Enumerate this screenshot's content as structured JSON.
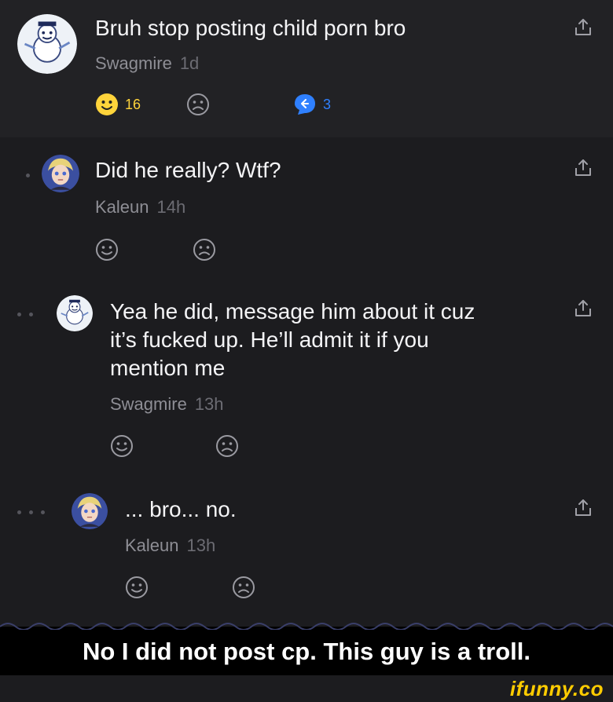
{
  "comments": [
    {
      "text": "Bruh stop posting child porn bro",
      "author": "Swagmire",
      "time": "1d",
      "smile_count": "16",
      "reply_count": "3"
    },
    {
      "text": "Did he really? Wtf?",
      "author": "Kaleun",
      "time": "14h"
    },
    {
      "text_lines": [
        "Yea he did, message him about it cuz",
        "it’s fucked up. He’ll admit it if you",
        "mention me"
      ],
      "author": "Swagmire",
      "time": "13h"
    },
    {
      "text": "... bro... no.",
      "author": "Kaleun",
      "time": "13h"
    }
  ],
  "caption": "No I did not post cp. This guy is a troll.",
  "watermark": "ifunny.co",
  "colors": {
    "smile_active": "#ffd43b",
    "reply_blue": "#2f80ff",
    "background": "#1c1c1f",
    "top_comment_bg": "#222225"
  },
  "icons": [
    "share-icon",
    "smile-icon",
    "frown-icon",
    "reply-icon",
    "avatar-snowman",
    "avatar-anime"
  ]
}
